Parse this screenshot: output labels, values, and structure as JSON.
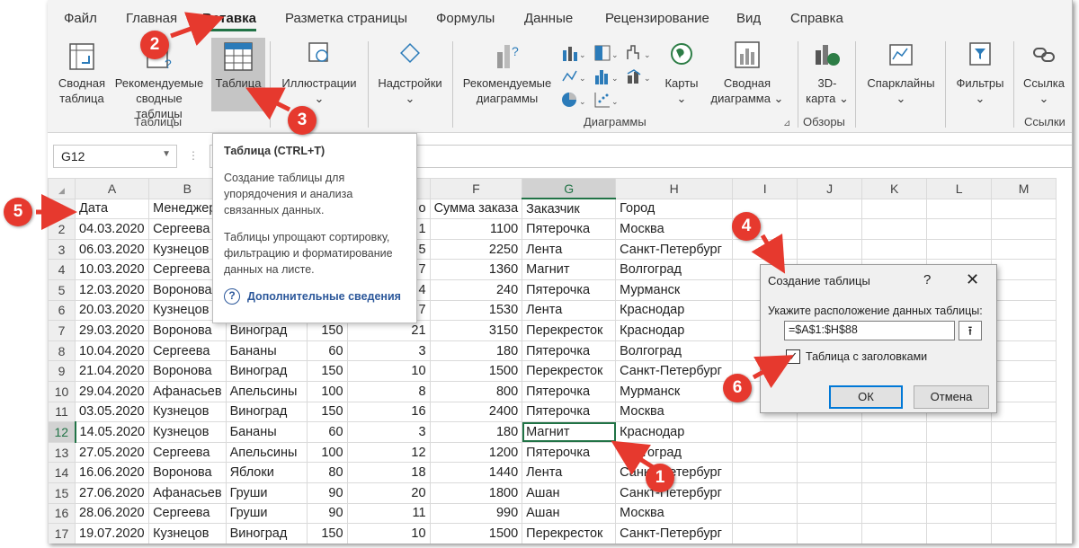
{
  "menu": {
    "tabs": [
      "Файл",
      "Главная",
      "Вставка",
      "Разметка страницы",
      "Формулы",
      "Данные",
      "Рецензирование",
      "Вид",
      "Справка"
    ],
    "active": "Вставка"
  },
  "ribbon": {
    "pivot_label_1": "Сводная",
    "pivot_label_2": "таблица",
    "rec_pivot_label_1": "Рекомендуемые",
    "rec_pivot_label_2": "сводные таблицы",
    "table_label": "Таблица",
    "illustrations_label": "Иллюстрации",
    "addins_label": "Надстройки",
    "rec_charts_label_1": "Рекомендуемые",
    "rec_charts_label_2": "диаграммы",
    "maps_label": "Карты",
    "pivotchart_label_1": "Сводная",
    "pivotchart_label_2": "диаграмма",
    "map3d_label_1": "3D-",
    "map3d_label_2": "карта",
    "sparklines_label": "Спарклайны",
    "filters_label": "Фильтры",
    "link_label": "Ссылка",
    "group_tables": "Таблицы",
    "group_charts": "Диаграммы",
    "group_tours": "Обзоры",
    "group_links": "Ссылки"
  },
  "formula_bar": {
    "name_box": "G12",
    "formula": ""
  },
  "tooltip": {
    "title": "Таблица (CTRL+T)",
    "para1": "Создание таблицы для упорядочения и анализа связанных данных.",
    "para2": "Таблицы упрощают сортировку, фильтрацию и форматирование данных на листе.",
    "more": "Дополнительные сведения"
  },
  "sheet": {
    "columns": [
      "A",
      "B",
      "C",
      "D",
      "E",
      "F",
      "G",
      "H",
      "I",
      "J",
      "K",
      "L",
      "M"
    ],
    "selected_column": "G",
    "selected_row": "12",
    "header_row": [
      "Дата",
      "Менеджер",
      "",
      "",
      "о",
      "Сумма заказа",
      "Заказчик",
      "Город"
    ],
    "rows": [
      [
        "2",
        "04.03.2020",
        "Сергеева",
        "",
        "",
        "1",
        "1100",
        "Пятерочка",
        "Москва"
      ],
      [
        "3",
        "06.03.2020",
        "Кузнецов",
        "",
        "",
        "5",
        "2250",
        "Лента",
        "Санкт-Петербург"
      ],
      [
        "4",
        "10.03.2020",
        "Сергеева",
        "",
        "",
        "7",
        "1360",
        "Магнит",
        "Волгоград"
      ],
      [
        "5",
        "12.03.2020",
        "Воронова",
        "",
        "",
        "4",
        "240",
        "Пятерочка",
        "Мурманск"
      ],
      [
        "6",
        "20.03.2020",
        "Кузнецов",
        "",
        "",
        "7",
        "1530",
        "Лента",
        "Краснодар"
      ],
      [
        "7",
        "29.03.2020",
        "Воронова",
        "Виноград",
        "150",
        "21",
        "3150",
        "Перекресток",
        "Краснодар"
      ],
      [
        "8",
        "10.04.2020",
        "Сергеева",
        "Бананы",
        "60",
        "3",
        "180",
        "Пятерочка",
        "Волгоград"
      ],
      [
        "9",
        "21.04.2020",
        "Воронова",
        "Виноград",
        "150",
        "10",
        "1500",
        "Перекресток",
        "Санкт-Петербург"
      ],
      [
        "10",
        "29.04.2020",
        "Афанасьев",
        "Апельсины",
        "100",
        "8",
        "800",
        "Пятерочка",
        "Мурманск"
      ],
      [
        "11",
        "03.05.2020",
        "Кузнецов",
        "Виноград",
        "150",
        "16",
        "2400",
        "Пятерочка",
        "Москва"
      ],
      [
        "12",
        "14.05.2020",
        "Кузнецов",
        "Бананы",
        "60",
        "3",
        "180",
        "Магнит",
        "Краснодар"
      ],
      [
        "13",
        "27.05.2020",
        "Сергеева",
        "Апельсины",
        "100",
        "12",
        "1200",
        "Пятерочка",
        "Волгоград"
      ],
      [
        "14",
        "16.06.2020",
        "Воронова",
        "Яблоки",
        "80",
        "18",
        "1440",
        "Лента",
        "Санкт-Петербург"
      ],
      [
        "15",
        "27.06.2020",
        "Афанасьев",
        "Груши",
        "90",
        "20",
        "1800",
        "Ашан",
        "Санкт-Петербург"
      ],
      [
        "16",
        "28.06.2020",
        "Сергеева",
        "Груши",
        "90",
        "11",
        "990",
        "Ашан",
        "Москва"
      ],
      [
        "17",
        "19.07.2020",
        "Кузнецов",
        "Виноград",
        "150",
        "10",
        "1500",
        "Перекресток",
        "Санкт-Петербург"
      ]
    ]
  },
  "dialog": {
    "title": "Создание таблицы",
    "help": "?",
    "close": "✕",
    "label": "Укажите расположение данных таблицы:",
    "range": "=$A$1:$H$88",
    "checkbox_label": "Таблица с заголовками",
    "checkbox_checked": "✓",
    "ok": "ОК",
    "cancel": "Отмена"
  },
  "callouts": [
    "1",
    "2",
    "3",
    "4",
    "5",
    "6"
  ],
  "colors": {
    "accent": "#217346",
    "callout": "#e6392e",
    "link": "#2b579a"
  }
}
